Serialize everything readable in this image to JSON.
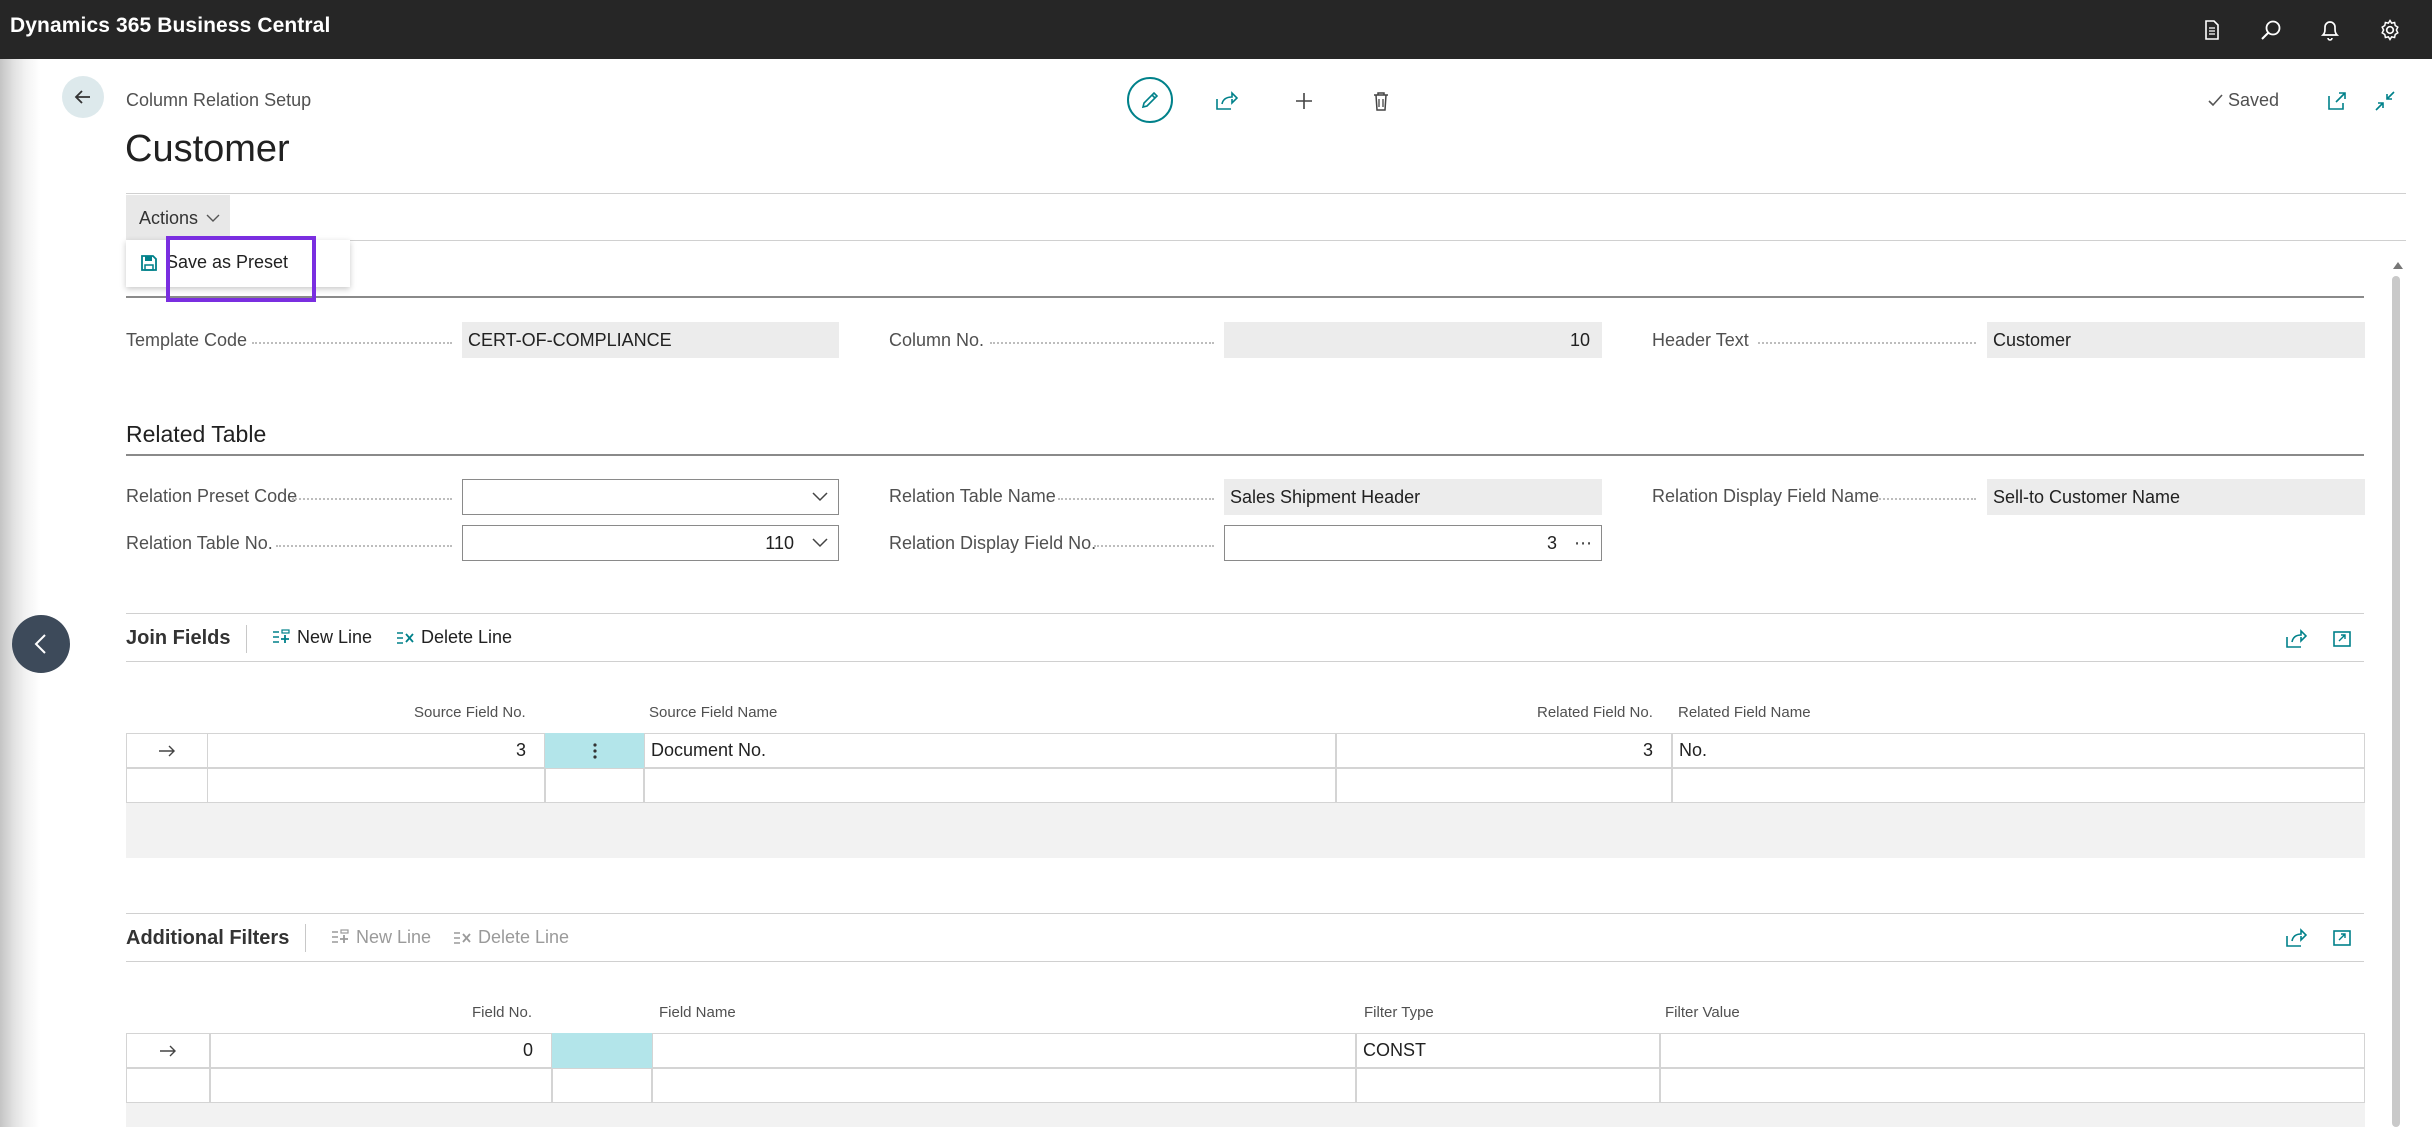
{
  "app": {
    "title": "Dynamics 365 Business Central"
  },
  "top_icons": [
    "document-icon",
    "search-icon",
    "bell-icon",
    "gear-icon"
  ],
  "header": {
    "breadcrumb": "Column Relation Setup",
    "title": "Customer",
    "status": "Saved"
  },
  "actions": {
    "tab_label": "Actions",
    "menu": [
      {
        "label": "Save as Preset"
      }
    ]
  },
  "general": {
    "template_code_label": "Template Code",
    "template_code_value": "CERT-OF-COMPLIANCE",
    "column_no_label": "Column No.",
    "column_no_value": "10",
    "header_text_label": "Header Text",
    "header_text_value": "Customer"
  },
  "related_table": {
    "title": "Related Table",
    "preset_code_label": "Relation Preset Code",
    "preset_code_value": "",
    "table_no_label": "Relation Table No.",
    "table_no_value": "110",
    "table_name_label": "Relation Table Name",
    "table_name_value": "Sales Shipment Header",
    "display_field_no_label": "Relation Display Field No.",
    "display_field_no_value": "3",
    "display_field_name_label": "Relation Display Field Name",
    "display_field_name_value": "Sell-to Customer Name"
  },
  "join_fields": {
    "title": "Join Fields",
    "new_line": "New Line",
    "delete_line": "Delete Line",
    "columns": [
      "Source Field No.",
      "Source Field Name",
      "Related Field No.",
      "Related Field Name"
    ],
    "rows": [
      {
        "source_field_no": "3",
        "source_field_name": "Document No.",
        "related_field_no": "3",
        "related_field_name": "No."
      }
    ]
  },
  "additional_filters": {
    "title": "Additional Filters",
    "new_line": "New Line",
    "delete_line": "Delete Line",
    "columns": [
      "Field No.",
      "Field Name",
      "Filter Type",
      "Filter Value"
    ],
    "rows": [
      {
        "field_no": "0",
        "field_name": "",
        "filter_type": "CONST",
        "filter_value": ""
      }
    ]
  },
  "colors": {
    "topbar": "#262626",
    "accent": "#00818a",
    "highlight": "#7a2ee0",
    "selected_cell": "#b3e5ea"
  }
}
